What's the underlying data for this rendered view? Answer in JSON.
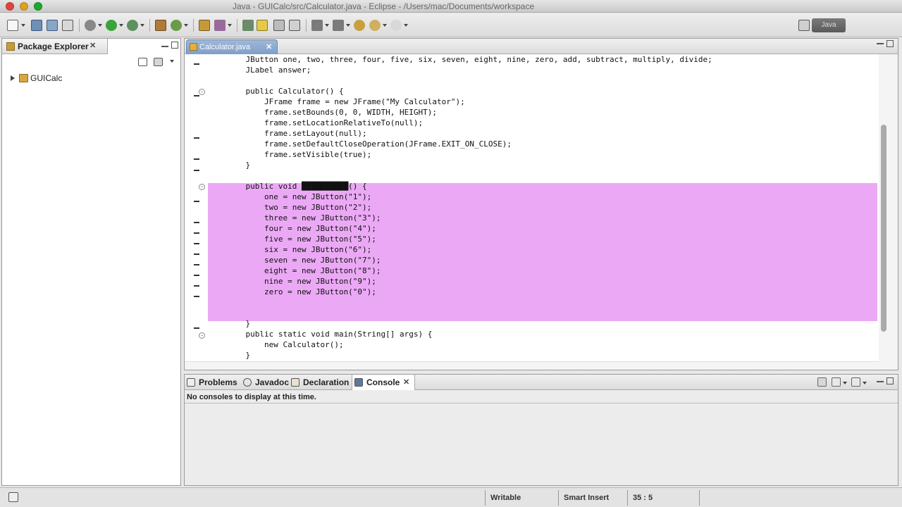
{
  "window": {
    "title": "Java - GUICalc/src/Calculator.java - Eclipse - /Users/mac/Documents/workspace"
  },
  "perspective": {
    "label": "Java"
  },
  "package_explorer": {
    "tab_label": "Package Explorer",
    "tree": [
      {
        "label": "GUICalc",
        "icon": "java-project-icon",
        "collapsed": true
      }
    ]
  },
  "editor": {
    "tab_label": "Calculator.java",
    "code_lines": [
      "    JButton one, two, three, four, five, six, seven, eight, nine, zero, add, subtract, multiply, divide;",
      "    JLabel answer;",
      "",
      "    public Calculator() {",
      "        JFrame frame = new JFrame(\"My Calculator\");",
      "        frame.setBounds(0, 0, WIDTH, HEIGHT);",
      "        frame.setLocationRelativeTo(null);",
      "        frame.setLayout(null);",
      "        frame.setDefaultCloseOperation(JFrame.EXIT_ON_CLOSE);",
      "        frame.setVisible(true);",
      "    }",
      "",
      "    public void ██████████() {",
      "        one = new JButton(\"1\");",
      "        two = new JButton(\"2\");",
      "        three = new JButton(\"3\");",
      "        four = new JButton(\"4\");",
      "        five = new JButton(\"5\");",
      "        six = new JButton(\"6\");",
      "        seven = new JButton(\"7\");",
      "        eight = new JButton(\"8\");",
      "        nine = new JButton(\"9\");",
      "        zero = new JButton(\"0\");",
      "",
      "",
      "    }",
      "    public static void main(String[] args) {",
      "        new Calculator();",
      "    }"
    ],
    "cursor_position": "35 : 5"
  },
  "bottom_panel": {
    "tabs": [
      {
        "label": "Problems",
        "icon": "problems-icon"
      },
      {
        "label": "Javadoc",
        "icon": "javadoc-icon"
      },
      {
        "label": "Declaration",
        "icon": "declaration-icon"
      },
      {
        "label": "Console",
        "icon": "console-icon",
        "active": true
      }
    ],
    "console_message": "No consoles to display at this time."
  },
  "status_bar": {
    "writable": "Writable",
    "insert_mode": "Smart Insert",
    "position": "35 : 5"
  },
  "colors": {
    "selection": "#eba9f5",
    "keyword": "#7f0055",
    "string": "#2a00ff",
    "constant": "#0000c0"
  }
}
